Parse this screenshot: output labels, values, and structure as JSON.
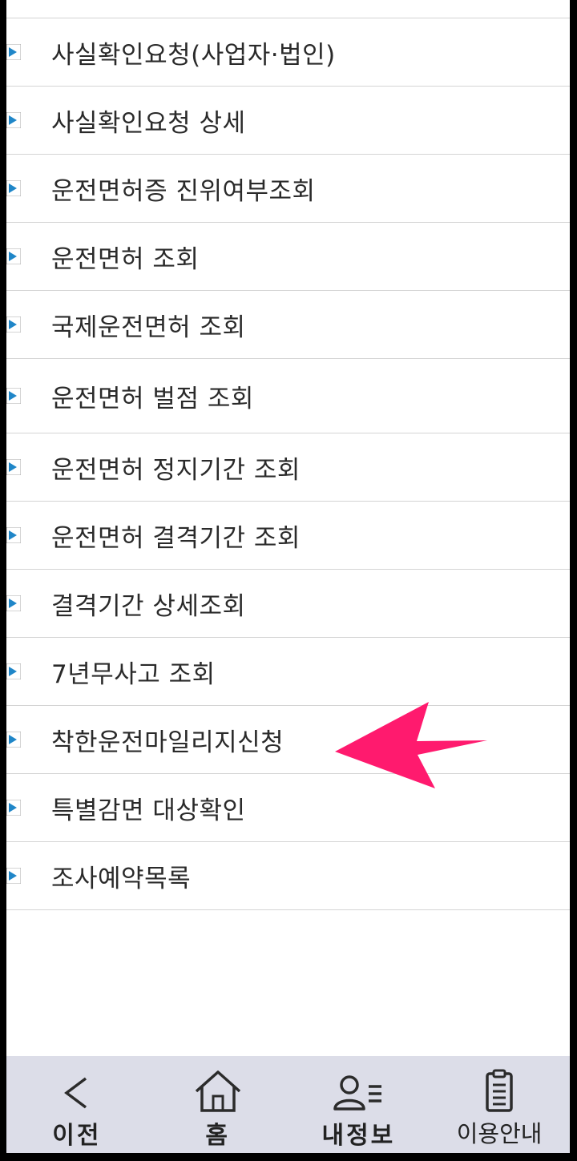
{
  "menu": {
    "items": [
      {
        "label": "사실확인요청(사업자·법인)"
      },
      {
        "label": "사실확인요청 상세"
      },
      {
        "label": "운전면허증 진위여부조회"
      },
      {
        "label": "운전면허 조회"
      },
      {
        "label": "국제운전면허 조회"
      },
      {
        "label": "운전면허 벌점 조회"
      },
      {
        "label": "운전면허 정지기간 조회"
      },
      {
        "label": "운전면허 결격기간 조회"
      },
      {
        "label": "결격기간 상세조회"
      },
      {
        "label": "7년무사고 조회"
      },
      {
        "label": "착한운전마일리지신청"
      },
      {
        "label": "특별감면 대상확인"
      },
      {
        "label": "조사예약목록"
      }
    ]
  },
  "bottom_nav": {
    "back": {
      "label": "이전",
      "icon": "chevron-left-icon"
    },
    "home": {
      "label": "홈",
      "icon": "home-icon"
    },
    "my_info": {
      "label": "내정보",
      "icon": "user-list-icon"
    },
    "guide": {
      "label": "이용안내",
      "icon": "clipboard-icon"
    }
  },
  "colors": {
    "annotation_arrow": "#ff1a6e",
    "nav_background": "#dcdde8",
    "bullet_blue": "#1f86c8"
  }
}
